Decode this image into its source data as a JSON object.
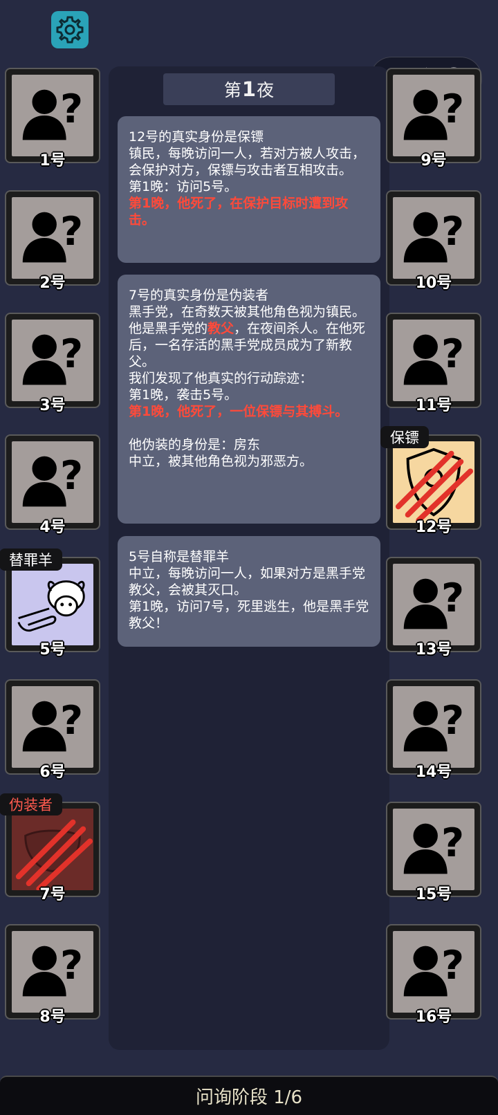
{
  "header": {
    "night_label": "第1夜",
    "night_prefix": "第",
    "night_number": "1",
    "night_suffix": "夜"
  },
  "cards": [
    {
      "lines": [
        "12号的真实身份是保镖",
        "镇民，每晚访问一人，若对方被人攻击，会保护对方，保镖与攻击者互相攻击。",
        "第1晚：访问5号。"
      ],
      "red": "第1晚，他死了，在保护目标时遭到攻击。"
    },
    {
      "line1": "7号的真实身份是伪装者",
      "line2": "黑手党，在奇数天被其他角色视为镇民。",
      "line3a": "他是黑手党的",
      "line3b": "教父",
      "line3c": "，在夜间杀人。在他死后，一名存活的黑手党成员成为了新教父。",
      "line4": "我们发现了他真实的行动踪迹：",
      "line5": "第1晚，袭击5号。",
      "red": "第1晚，他死了，一位保镖与其搏斗。",
      "line6": "他伪装的身份是：房东",
      "line7": "中立，被其他角色视为邪恶方。"
    },
    {
      "line1": "5号自称是替罪羊",
      "line2": "中立，每晚访问一人，如果对方是黑手党教父，会被其灭口。",
      "line3": "第1晚，访问7号，死里逃生，他是黑手党教父！"
    }
  ],
  "players": [
    {
      "label": "1号",
      "role": "",
      "icon": "unknown-player-icon"
    },
    {
      "label": "2号",
      "role": "",
      "icon": "unknown-player-icon"
    },
    {
      "label": "3号",
      "role": "",
      "icon": "unknown-player-icon"
    },
    {
      "label": "4号",
      "role": "",
      "icon": "unknown-player-icon"
    },
    {
      "label": "5号",
      "role": "替罪羊",
      "icon": "scapegoat-sheep-icon"
    },
    {
      "label": "6号",
      "role": "",
      "icon": "unknown-player-icon"
    },
    {
      "label": "7号",
      "role": "伪装者",
      "icon": "disguiser-mask-slashed-icon"
    },
    {
      "label": "8号",
      "role": "",
      "icon": "unknown-player-icon"
    },
    {
      "label": "9号",
      "role": "",
      "icon": "unknown-player-icon"
    },
    {
      "label": "10号",
      "role": "",
      "icon": "unknown-player-icon"
    },
    {
      "label": "11号",
      "role": "",
      "icon": "unknown-player-icon"
    },
    {
      "label": "12号",
      "role": "保镖",
      "icon": "bodyguard-shield-slashed-icon"
    },
    {
      "label": "13号",
      "role": "",
      "icon": "unknown-player-icon"
    },
    {
      "label": "14号",
      "role": "",
      "icon": "unknown-player-icon"
    },
    {
      "label": "15号",
      "role": "",
      "icon": "unknown-player-icon"
    },
    {
      "label": "16号",
      "role": "",
      "icon": "unknown-player-icon"
    }
  ],
  "footer": {
    "phase_label": "问询阶段 1/6"
  },
  "colors": {
    "background": "#262a42",
    "card": "#5c6279",
    "accent_red": "#ff4a3a",
    "gear": "#2aa3b8"
  }
}
